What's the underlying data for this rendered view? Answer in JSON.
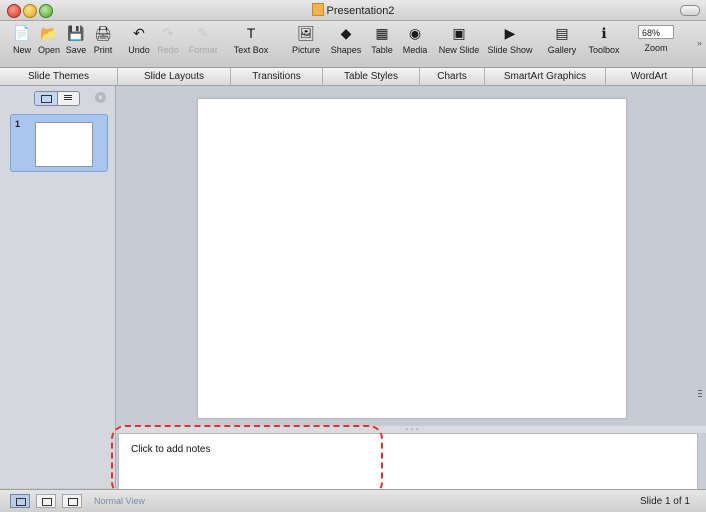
{
  "window": {
    "title": "Presentation2"
  },
  "toolbar": {
    "items": [
      {
        "label": "New",
        "icon": "new-icon",
        "glyph": "📄",
        "enabled": true
      },
      {
        "label": "Open",
        "icon": "open-icon",
        "glyph": "📂",
        "enabled": true
      },
      {
        "label": "Save",
        "icon": "save-icon",
        "glyph": "💾",
        "enabled": true
      },
      {
        "label": "Print",
        "icon": "print-icon",
        "glyph": "🖨",
        "enabled": true
      },
      {
        "label": "Undo",
        "icon": "undo-icon",
        "glyph": "↶",
        "enabled": true
      },
      {
        "label": "Redo",
        "icon": "redo-icon",
        "glyph": "↷",
        "enabled": false
      },
      {
        "label": "Format",
        "icon": "format-icon",
        "glyph": "✎",
        "enabled": false
      },
      {
        "label": "Text Box",
        "icon": "text-box-icon",
        "glyph": "T",
        "enabled": true
      },
      {
        "label": "Picture",
        "icon": "picture-icon",
        "glyph": "🖼",
        "enabled": true
      },
      {
        "label": "Shapes",
        "icon": "shapes-icon",
        "glyph": "◆",
        "enabled": true
      },
      {
        "label": "Table",
        "icon": "table-icon",
        "glyph": "▦",
        "enabled": true
      },
      {
        "label": "Media",
        "icon": "media-icon",
        "glyph": "◉",
        "enabled": true
      },
      {
        "label": "New Slide",
        "icon": "new-slide-icon",
        "glyph": "▣",
        "enabled": true
      },
      {
        "label": "Slide Show",
        "icon": "slide-show-icon",
        "glyph": "▶",
        "enabled": true
      },
      {
        "label": "Gallery",
        "icon": "gallery-icon",
        "glyph": "▤",
        "enabled": true
      },
      {
        "label": "Toolbox",
        "icon": "toolbox-icon",
        "glyph": "ℹ",
        "enabled": true
      }
    ],
    "zoom": {
      "label": "Zoom",
      "value": "68%"
    }
  },
  "ribbon": {
    "tabs": [
      "Slide Themes",
      "Slide Layouts",
      "Transitions",
      "Table Styles",
      "Charts",
      "SmartArt Graphics",
      "WordArt"
    ]
  },
  "sidebar": {
    "slides": [
      {
        "number": "1"
      }
    ]
  },
  "notes": {
    "placeholder": "Click to add notes"
  },
  "status": {
    "view": "Normal View",
    "page": "Slide 1 of 1"
  }
}
